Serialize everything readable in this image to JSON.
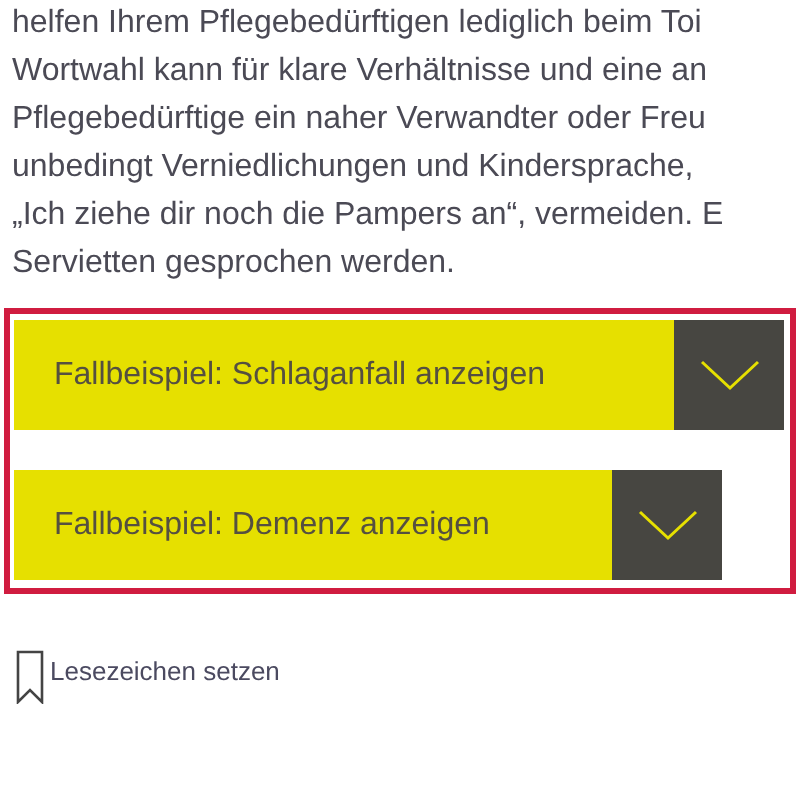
{
  "paragraph_lines": [
    "helfen Ihrem Pflegebedürftigen lediglich beim Toi",
    "Wortwahl kann für klare Verhältnisse und eine an",
    "Pflegebedürftige ein naher Verwandter oder Freu",
    "unbedingt Verniedlichungen und Kindersprache,",
    "„Ich ziehe dir noch die Pampers an“, vermeiden. E",
    "Servietten gesprochen werden."
  ],
  "case_examples": [
    {
      "label": "Fallbeispiel: Schlaganfall anzeigen",
      "expanded": false
    },
    {
      "label": "Fallbeispiel: Demenz anzeigen",
      "expanded": false
    }
  ],
  "bookmark": {
    "label": "Lesezeichen setzen"
  }
}
